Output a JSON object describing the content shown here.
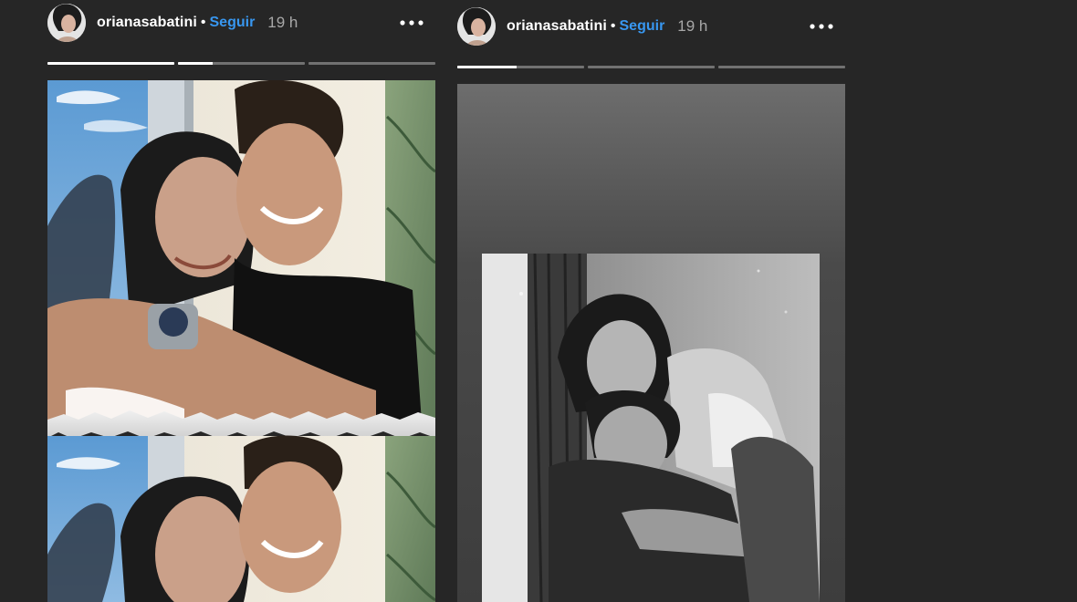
{
  "stories": [
    {
      "username": "orianasabatini",
      "separator": "•",
      "follow_label": "Seguir",
      "time": "19 h",
      "progress": [
        1,
        0.27,
        0
      ]
    },
    {
      "username": "orianasabatini",
      "separator": "•",
      "follow_label": "Seguir",
      "time": "19 h",
      "progress": [
        0.47,
        0,
        0
      ]
    }
  ],
  "colors": {
    "background": "#262626",
    "follow": "#3897f0",
    "timestamp": "#a8a8a8"
  },
  "icons": {
    "more": "more-horizontal-icon"
  }
}
